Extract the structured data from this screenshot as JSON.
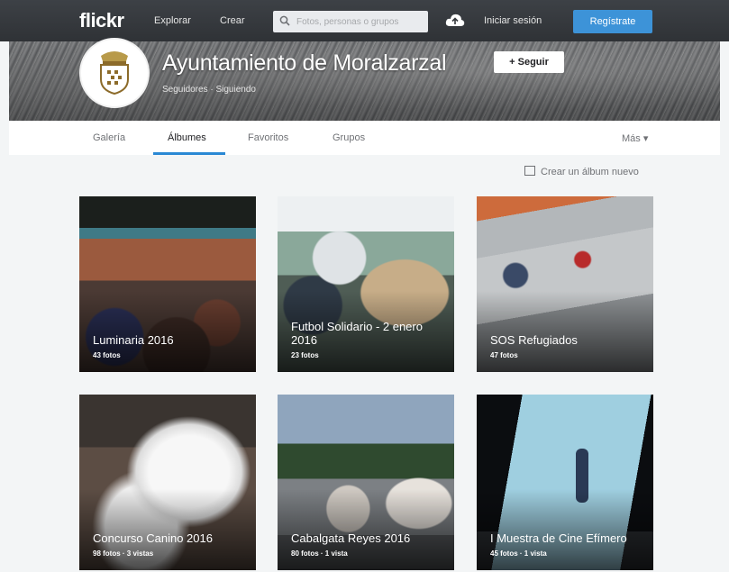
{
  "nav": {
    "logo": "flickr",
    "explore": "Explorar",
    "create": "Crear",
    "search_placeholder": "Fotos, personas o grupos",
    "login": "Iniciar sesión",
    "signup": "Regístrate"
  },
  "profile": {
    "name": "Ayuntamiento de Moralzarzal",
    "follow": "+ Seguir",
    "stats": "Seguidores · Siguiendo"
  },
  "tabs": [
    {
      "label": "Galería"
    },
    {
      "label": "Álbumes"
    },
    {
      "label": "Favoritos"
    },
    {
      "label": "Grupos"
    }
  ],
  "more": "Más ▾",
  "create_album": "Crear un álbum nuevo",
  "albums": [
    {
      "title": "Luminaria 2016",
      "meta": "43 fotos"
    },
    {
      "title": "Futbol Solidario - 2 enero 2016",
      "meta": "23 fotos"
    },
    {
      "title": "SOS Refugiados",
      "meta": "47 fotos"
    },
    {
      "title": "Concurso Canino 2016",
      "meta": "98 fotos · 3 vistas"
    },
    {
      "title": "Cabalgata Reyes 2016",
      "meta": "80 fotos · 1 vista"
    },
    {
      "title": "I Muestra de Cine Efímero",
      "meta": "45 fotos · 1 vista"
    }
  ],
  "colors": {
    "topbar": "#34373b",
    "accent": "#3d93d8",
    "tab_underline": "#2a88d4",
    "page_bg": "#f3f5f6"
  },
  "icons": [
    "search-icon",
    "upload-cloud-icon",
    "crest-logo",
    "add-album-icon"
  ]
}
